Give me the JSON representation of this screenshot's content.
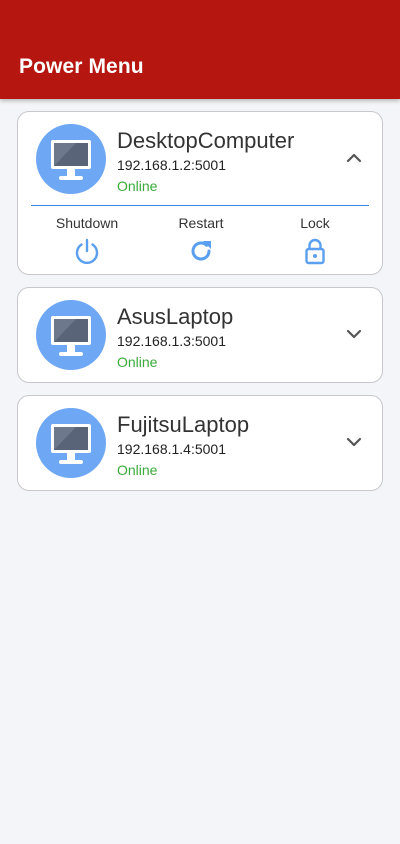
{
  "appbar": {
    "title": "Power Menu"
  },
  "colors": {
    "appbar": "#b5160f",
    "accent": "#6ea8f5",
    "status_online": "#3aaa3a",
    "divider": "#3a86e8"
  },
  "devices": [
    {
      "name": "DesktopComputer",
      "address": "192.168.1.2:5001",
      "status": "Online",
      "expanded": true,
      "chevron_icon": "chevron-up-icon",
      "actions": [
        {
          "label": "Shutdown",
          "icon": "power-icon"
        },
        {
          "label": "Restart",
          "icon": "refresh-icon"
        },
        {
          "label": "Lock",
          "icon": "lock-icon"
        }
      ]
    },
    {
      "name": "AsusLaptop",
      "address": "192.168.1.3:5001",
      "status": "Online",
      "expanded": false,
      "chevron_icon": "chevron-down-icon"
    },
    {
      "name": "FujitsuLaptop",
      "address": "192.168.1.4:5001",
      "status": "Online",
      "expanded": false,
      "chevron_icon": "chevron-down-icon"
    }
  ]
}
